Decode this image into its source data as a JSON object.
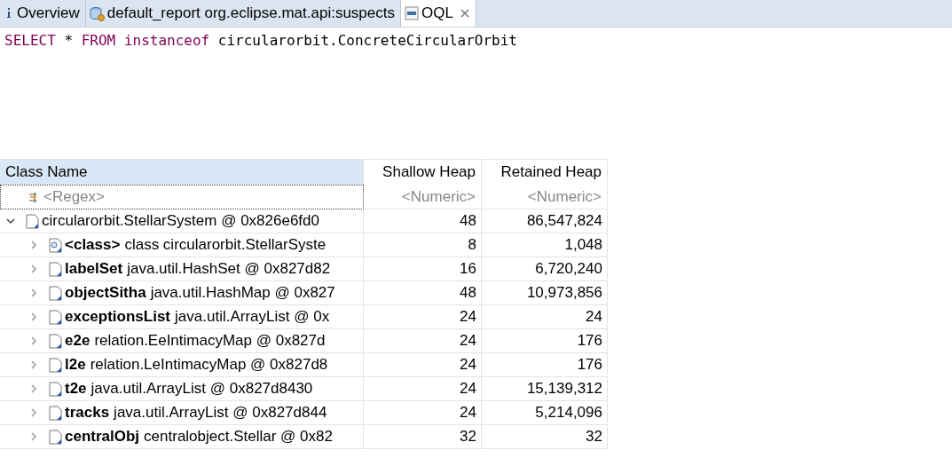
{
  "tabs": [
    {
      "label": "Overview",
      "selected": false,
      "closable": false
    },
    {
      "label": "default_report  org.eclipse.mat.api:suspects",
      "selected": false,
      "closable": false
    },
    {
      "label": "OQL",
      "selected": true,
      "closable": true
    }
  ],
  "query": [
    {
      "kind": "keyword",
      "text": "SELECT"
    },
    {
      "kind": "plain",
      "text": "*"
    },
    {
      "kind": "keyword",
      "text": "FROM"
    },
    {
      "kind": "keyword",
      "text": "instanceof"
    },
    {
      "kind": "plain",
      "text": "circularorbit.ConcreteCircularOrbit"
    }
  ],
  "table": {
    "columns": [
      {
        "label": "Class Name",
        "selected": true
      },
      {
        "label": "Shallow Heap",
        "selected": false
      },
      {
        "label": "Retained Heap",
        "selected": false
      }
    ],
    "filters": [
      "<Regex>",
      "<Numeric>",
      "<Numeric>"
    ],
    "rows": [
      {
        "name": "circularorbit.StellarSystem @ 0x826e6fd0",
        "shallow": "48",
        "retained": "86,547,824",
        "expanded": true,
        "children": [
          {
            "field": "<class>",
            "name": "class circularorbit.StellarSyste",
            "shallow": "8",
            "retained": "1,048",
            "kind": "class",
            "expanded": false
          },
          {
            "field": "labelSet",
            "name": "java.util.HashSet @ 0x827d82",
            "shallow": "16",
            "retained": "6,720,240",
            "kind": "object",
            "expanded": false
          },
          {
            "field": "objectSitha",
            "name": "java.util.HashMap @ 0x827",
            "shallow": "48",
            "retained": "10,973,856",
            "kind": "object",
            "expanded": false
          },
          {
            "field": "exceptionsList",
            "name": "java.util.ArrayList @ 0x",
            "shallow": "24",
            "retained": "24",
            "kind": "object",
            "expanded": false
          },
          {
            "field": "e2e",
            "name": "relation.EeIntimacyMap @ 0x827d",
            "shallow": "24",
            "retained": "176",
            "kind": "object",
            "expanded": false
          },
          {
            "field": "l2e",
            "name": "relation.LeIntimacyMap @ 0x827d8",
            "shallow": "24",
            "retained": "176",
            "kind": "object",
            "expanded": false
          },
          {
            "field": "t2e",
            "name": "java.util.ArrayList @ 0x827d8430",
            "shallow": "24",
            "retained": "15,139,312",
            "kind": "object",
            "expanded": false
          },
          {
            "field": "tracks",
            "name": "java.util.ArrayList @ 0x827d844",
            "shallow": "24",
            "retained": "5,214,096",
            "kind": "object",
            "expanded": false
          },
          {
            "field": "centralObj",
            "name": "centralobject.Stellar @ 0x82",
            "shallow": "32",
            "retained": "32",
            "kind": "object",
            "expanded": false
          }
        ]
      }
    ]
  }
}
